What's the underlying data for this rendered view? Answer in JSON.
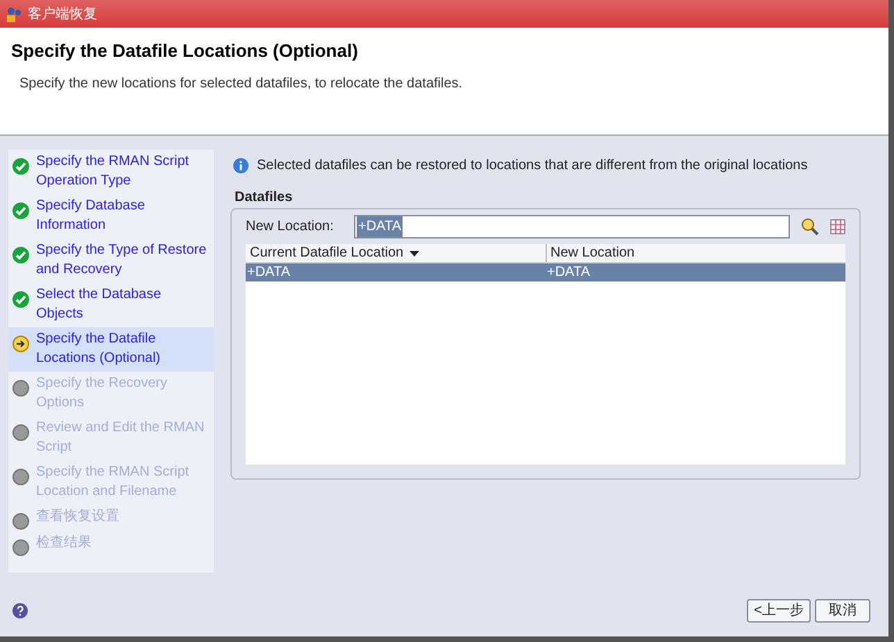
{
  "window": {
    "title": "客户端恢复"
  },
  "header": {
    "title": "Specify the Datafile Locations (Optional)",
    "description": "Specify the new locations for selected datafiles, to relocate the datafiles."
  },
  "steps": [
    {
      "label": "Specify the RMAN Script Operation Type",
      "kind": "done",
      "selected": false
    },
    {
      "label": "Specify Database Information",
      "kind": "done",
      "selected": false
    },
    {
      "label": "Specify the Type of Restore and Recovery",
      "kind": "done",
      "selected": false
    },
    {
      "label": "Select the Database Objects",
      "kind": "done",
      "selected": false
    },
    {
      "label": "Specify the Datafile Locations (Optional)",
      "kind": "current",
      "selected": true
    },
    {
      "label": "Specify the Recovery Options",
      "kind": "pending",
      "selected": false
    },
    {
      "label": "Review and Edit the RMAN Script",
      "kind": "pending",
      "selected": false
    },
    {
      "label": "Specify the RMAN Script Location and Filename",
      "kind": "pending",
      "selected": false
    },
    {
      "label": "查看恢复设置",
      "kind": "pending",
      "selected": false
    },
    {
      "label": "检查结果",
      "kind": "pending",
      "selected": false
    }
  ],
  "info": "Selected datafiles can be restored to locations that are different from the original locations",
  "datafiles": {
    "title": "Datafiles",
    "new_location_label": "New Location:",
    "new_location_value": "+DATA",
    "columns": [
      "Current Datafile Location",
      "New Location"
    ],
    "rows": [
      {
        "cells": [
          "+DATA",
          "+DATA"
        ],
        "selected": true
      }
    ]
  },
  "buttons": [
    "<上一步",
    "取消"
  ]
}
